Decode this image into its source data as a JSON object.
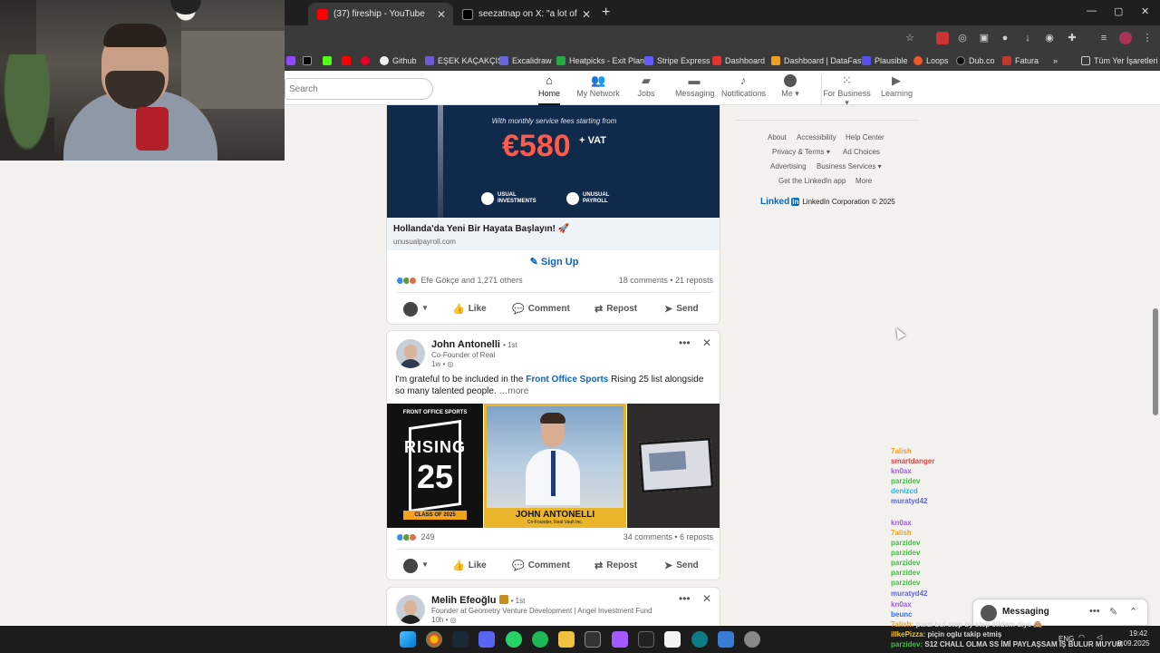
{
  "browser": {
    "tabs": [
      {
        "title": "(37) fireship - YouTube",
        "active": true
      },
      {
        "title": "seezatnap on X: \"a lot of peopl",
        "active": false
      }
    ],
    "new_tab": "+",
    "tab_close": "✕",
    "window_controls": [
      "—",
      "▢",
      "✕"
    ]
  },
  "bookmarks": [
    {
      "label": "",
      "icon": "twitch-icon"
    },
    {
      "label": "",
      "icon": "x-icon"
    },
    {
      "label": "",
      "icon": "kick-icon"
    },
    {
      "label": "",
      "icon": "youtube-icon"
    },
    {
      "label": "",
      "icon": "pinterest-icon"
    },
    {
      "label": "Github"
    },
    {
      "label": "EŞEK KAÇAKÇISI"
    },
    {
      "label": "Excalidraw"
    },
    {
      "label": "Heatpicks - Exit Plan"
    },
    {
      "label": "Stripe Express"
    },
    {
      "label": "Dashboard"
    },
    {
      "label": "Dashboard | DataFast"
    },
    {
      "label": "Plausible"
    },
    {
      "label": "Loops"
    },
    {
      "label": "Dub.co"
    },
    {
      "label": "Fatura"
    },
    {
      "label": "»"
    },
    {
      "label": "Tüm Yer İşaretleri"
    }
  ],
  "linkedin_header": {
    "search_placeholder": "Search",
    "nav": [
      {
        "label": "Home",
        "icon": "home-icon"
      },
      {
        "label": "My Network",
        "icon": "network-icon"
      },
      {
        "label": "Jobs",
        "icon": "briefcase-icon"
      },
      {
        "label": "Messaging",
        "icon": "chat-icon"
      },
      {
        "label": "Notifications",
        "icon": "bell-icon"
      },
      {
        "label": "Me",
        "icon": "avatar-icon"
      },
      {
        "label": "For Business",
        "icon": "grid-icon"
      },
      {
        "label": "Learning",
        "icon": "play-icon"
      }
    ]
  },
  "ad_post": {
    "fees_text": "With monthly service fees starting from",
    "price": "€580",
    "vat": "+ VAT",
    "logo1": "USUAL INVESTMENTS",
    "logo2": "UNUSUAL PAYROLL",
    "headline": "Hollanda'da Yeni Bir Hayata Başlayın! 🚀",
    "domain": "unusualpayroll.com",
    "cta": "Sign Up",
    "reactions_text": "Efe Gökçe and 1,271 others",
    "comments_reposts": "18 comments • 21 reposts"
  },
  "actions": {
    "like": "Like",
    "comment": "Comment",
    "repost": "Repost",
    "send": "Send"
  },
  "post1": {
    "author": "John Antonelli",
    "degree": "• 1st",
    "title": "Co-Founder of Real",
    "time": "1w •",
    "text_before": "I'm grateful to be included in the ",
    "text_link": "Front Office Sports",
    "text_after": " Rising 25 list alongside so many talented people.",
    "more": " …more",
    "img_fos": "FRONT OFFICE SPORTS",
    "img_rising": "RISING",
    "img_25": "25",
    "img_class": "CLASS OF 2025",
    "img_name": "JOHN ANTONELLI",
    "img_sub": "Co-Founder, Real Vault Inc.",
    "reactions_count": "249",
    "comments_reposts": "34 comments • 6 reposts"
  },
  "post2": {
    "author": "Melih Efeoğlu",
    "degree": "• 1st",
    "title": "Founder at Geometry Venture Development | Angel Investment Fund",
    "time": "10h •"
  },
  "right_rail": {
    "links": [
      "About",
      "Accessibility",
      "Help Center",
      "Privacy & Terms ▾",
      "Ad Choices",
      "Advertising",
      "Business Services ▾",
      "Get the LinkedIn app",
      "More"
    ],
    "brand_logo": "Linked",
    "brand_in": "in",
    "copyright": "LinkedIn Corporation © 2025"
  },
  "chat": [
    {
      "user": "7alish",
      "color": "#f0a020",
      "msg": ""
    },
    {
      "user": "smartdanger",
      "color": "#e04040",
      "msg": ""
    },
    {
      "user": "kn0ax",
      "color": "#9b5bf0",
      "msg": ""
    },
    {
      "user": "parzidev",
      "color": "#40c040",
      "msg": ""
    },
    {
      "user": "denizcd",
      "color": "#30b0e0",
      "msg": ""
    },
    {
      "user": "muratyd42",
      "color": "#6060f0",
      "msg": ""
    },
    {
      "user": "kn0ax",
      "color": "#9b5bf0",
      "msg": ""
    },
    {
      "user": "7alish",
      "color": "#f0a020",
      "msg": ""
    },
    {
      "user": "parzidev",
      "color": "#40c040",
      "msg": ""
    },
    {
      "user": "parzidev",
      "color": "#40c040",
      "msg": ""
    },
    {
      "user": "parzidev",
      "color": "#40c040",
      "msg": ""
    },
    {
      "user": "parzidev",
      "color": "#40c040",
      "msg": ""
    },
    {
      "user": "parzidev",
      "color": "#40c040",
      "msg": ""
    },
    {
      "user": "muratyd42",
      "color": "#6060f0",
      "msg": ""
    },
    {
      "user": "kn0ax",
      "color": "#9b5bf0",
      "msg": ""
    },
    {
      "user": "beunc",
      "color": "#3070f0",
      "msg": ""
    },
    {
      "user": "7alish:",
      "color": "#f0a020",
      "msg": "parzi bul step by step sildem diye 🙈"
    },
    {
      "user": "illkePizza:",
      "color": "#f0c020",
      "msg": "piçin oglu takip etmiş"
    },
    {
      "user": "parzidev:",
      "color": "#40c040",
      "msg": "S12 CHALL OLMA SS İMİ PAYLAŞSAM İŞ BULUR MUYUM"
    }
  ],
  "messaging_widget": {
    "label": "Messaging"
  },
  "taskbar": {
    "lang": "ENG",
    "time": "19:42",
    "date": "8.09.2025"
  }
}
